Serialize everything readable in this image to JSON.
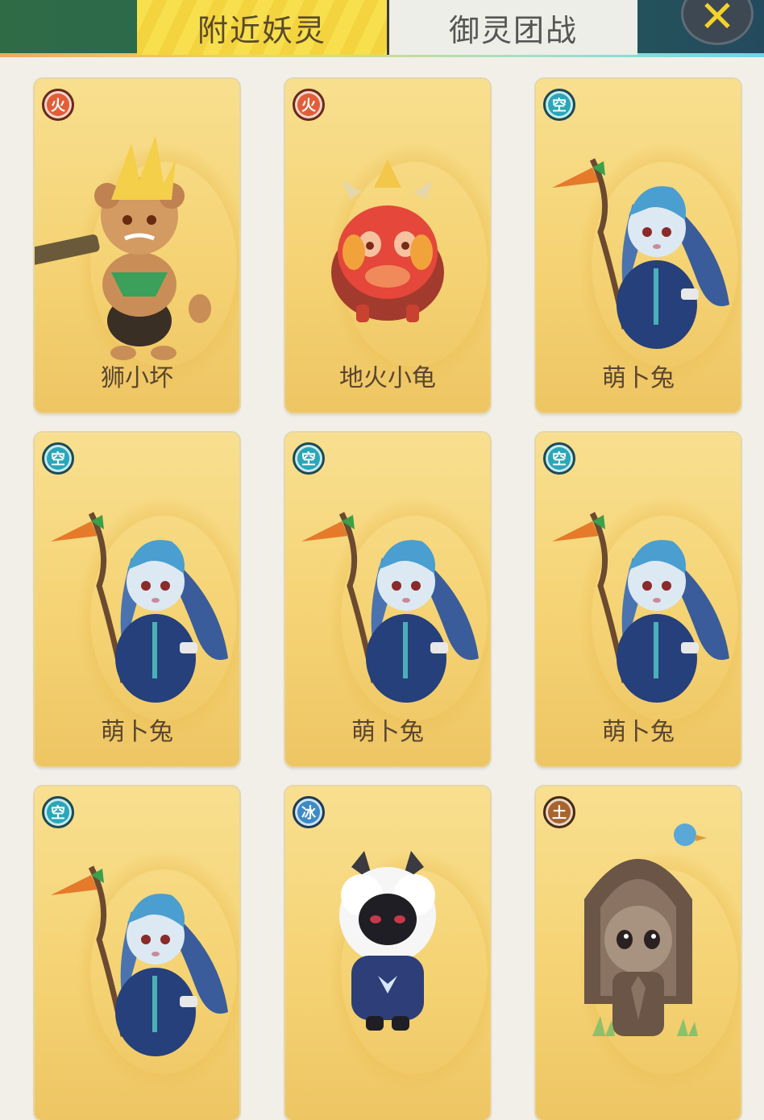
{
  "header": {
    "tabs": [
      {
        "label": "附近妖灵",
        "active": true
      },
      {
        "label": "御灵团战",
        "active": false
      }
    ],
    "close_icon": "close-icon"
  },
  "colors": {
    "tab_active": "#f7df4e",
    "card_bg": "#f5d374",
    "fire": "#e35d38",
    "sky": "#2aa6b9",
    "ice": "#3d8ac8",
    "earth": "#a7642c"
  },
  "cards": [
    {
      "element": "火",
      "element_type": "fire",
      "name": "狮小坏",
      "creature": "lion"
    },
    {
      "element": "火",
      "element_type": "fire",
      "name": "地火小龟",
      "creature": "turtle"
    },
    {
      "element": "空",
      "element_type": "sky",
      "name": "萌卜兔",
      "creature": "rabbit"
    },
    {
      "element": "空",
      "element_type": "sky",
      "name": "萌卜兔",
      "creature": "rabbit"
    },
    {
      "element": "空",
      "element_type": "sky",
      "name": "萌卜兔",
      "creature": "rabbit"
    },
    {
      "element": "空",
      "element_type": "sky",
      "name": "萌卜兔",
      "creature": "rabbit"
    },
    {
      "element": "空",
      "element_type": "sky",
      "name": "",
      "creature": "rabbit"
    },
    {
      "element": "冰",
      "element_type": "ice",
      "name": "",
      "creature": "cat"
    },
    {
      "element": "土",
      "element_type": "earth",
      "name": "",
      "creature": "statue"
    }
  ]
}
